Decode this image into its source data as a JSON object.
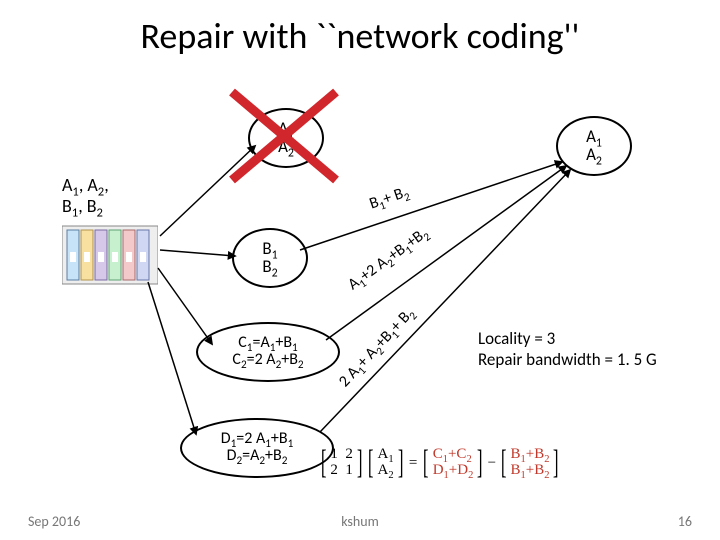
{
  "title": "Repair with ``network coding''",
  "source_label_html": "A<sub>1</sub>, A<sub>2</sub>,<br>B<sub>1</sub>, B<sub>2</sub>",
  "nodes": {
    "A": {
      "lines": [
        "A<sub>1</sub>",
        "A<sub>2</sub>"
      ]
    },
    "B": {
      "lines": [
        "B<sub>1</sub>",
        "B<sub>2</sub>"
      ]
    },
    "C": {
      "lines": [
        "C<sub>1</sub>=A<sub>1</sub>+B<sub>1</sub>",
        "C<sub>2</sub>=2 A<sub>2</sub>+B<sub>2</sub>"
      ]
    },
    "D": {
      "lines": [
        "D<sub>1</sub>=2 A<sub>1</sub>+B<sub>1</sub>",
        "D<sub>2</sub>=A<sub>2</sub>+B<sub>2</sub>"
      ]
    },
    "Anew": {
      "lines": [
        "A<sub>1</sub>",
        "A<sub>2</sub>"
      ]
    }
  },
  "edges": {
    "b_to_new": "B<sub>1</sub>+ B<sub>2</sub>",
    "c1_to_new": "A<sub>1</sub>+2 A<sub>2</sub>+B<sub>1</sub>+B<sub>2</sub>",
    "c2_to_new": "2 A<sub>1</sub>+ A<sub>2</sub>+B<sub>1</sub>+ B<sub>2</sub>"
  },
  "locality": {
    "line1": "Locality = 3",
    "line2": "Repair bandwidth = 1. 5 G"
  },
  "footer": {
    "left": "Sep 2016",
    "center": "kshum",
    "right": "16"
  },
  "chart_data": {
    "type": "diagram",
    "title": "Repair with network coding",
    "source": {
      "label": "A1, A2, B1, B2"
    },
    "storage_nodes": [
      {
        "id": "A",
        "contents": [
          "A1",
          "A2"
        ],
        "status": "failed"
      },
      {
        "id": "B",
        "contents": [
          "B1",
          "B2"
        ],
        "status": "ok"
      },
      {
        "id": "C",
        "contents": [
          "C1 = A1 + B1",
          "C2 = 2 A2 + B2"
        ],
        "status": "ok"
      },
      {
        "id": "D",
        "contents": [
          "D1 = 2 A1 + B1",
          "D2 = A2 + B2"
        ],
        "status": "ok"
      },
      {
        "id": "A_new",
        "contents": [
          "A1",
          "A2"
        ],
        "status": "repaired"
      }
    ],
    "repair_edges": [
      {
        "from": "B",
        "to": "A_new",
        "sends": "B1 + B2"
      },
      {
        "from": "C",
        "to": "A_new",
        "sends": "A1 + 2 A2 + B1 + B2"
      },
      {
        "from": "D",
        "to": "A_new",
        "sends": "2 A1 + A2 + B1 + B2"
      }
    ],
    "decode_equation": {
      "lhs": [
        [
          1,
          2
        ],
        [
          2,
          1
        ]
      ],
      "vec": [
        "A1",
        "A2"
      ],
      "rhs_terms": [
        [
          "C1 + C2",
          "D1 + D2"
        ],
        [
          "B1 + B2",
          "B1 + B2"
        ]
      ],
      "rhs_op": "minus"
    },
    "annotations": {
      "locality": 3,
      "repair_bandwidth": "1.5 G"
    }
  }
}
